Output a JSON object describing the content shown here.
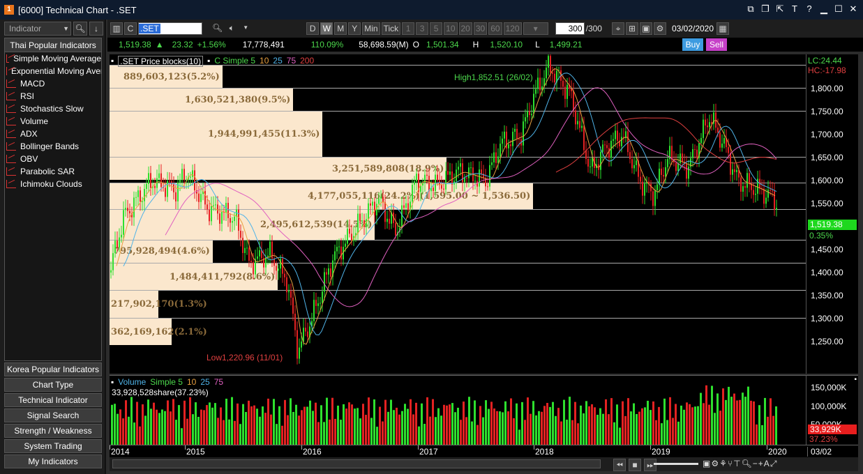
{
  "window": {
    "badge": "1",
    "title": "[6000] Technical Chart - .SET"
  },
  "sidebar": {
    "indicator_placeholder": "Indicator",
    "panel_title": "Thai Popular Indicators",
    "items": [
      "Simple Moving Average",
      "Exponential Moving Average",
      "MACD",
      "RSI",
      "Stochastics Slow",
      "Volume",
      "ADX",
      "Bollinger Bands",
      "OBV",
      "Parabolic SAR",
      "Ichimoku Clouds"
    ],
    "buttons": [
      "Korea Popular Indicators",
      "Chart Type",
      "Technical Indicator",
      "Signal Search",
      "Strength / Weakness",
      "System Trading",
      "My Indicators"
    ]
  },
  "toolbar": {
    "symbol": ".SET",
    "periods": [
      "D",
      "W",
      "M",
      "Y",
      "Min",
      "Tick"
    ],
    "active_period": "W",
    "intervals": [
      "1",
      "3",
      "5",
      "10",
      "20",
      "30",
      "60",
      "120"
    ],
    "count": "300",
    "count_total": "/300",
    "date": "03/02/2020"
  },
  "quote": {
    "last": "1,519.38",
    "change": "23.32",
    "change_pct": "+1.56%",
    "volume": "17,778,491",
    "vol_ratio": "110.09%",
    "value": "58,698.59(M)",
    "open_label": "O",
    "open": "1,501.34",
    "high_label": "H",
    "high": "1,520.10",
    "low_label": "L",
    "low": "1,499.21",
    "buy": "Buy",
    "sell": "Sell"
  },
  "chart": {
    "legend_block": ".SET Price blocks(10)",
    "legend_ma": "C Simple 5",
    "ma_periods": [
      "10",
      "25",
      "75",
      "200"
    ],
    "ma_colors": [
      "#4cd84c",
      "#e8a040",
      "#4fb3e8",
      "#e060c0",
      "#e04040"
    ],
    "high_label": "High1,852.51 (26/02)",
    "low_label": "Low1,220.96 (11/01)",
    "lc": "LC:24.44",
    "hc": "HC:-17.98",
    "last_price": "1,519.38",
    "last_pct": "0.35%",
    "y_ticks": [
      "1,800.00",
      "1,750.00",
      "1,700.00",
      "1,650.00",
      "1,600.00",
      "1,550.00",
      "1,500.00",
      "1,450.00",
      "1,400.00",
      "1,350.00",
      "1,300.00",
      "1,250.00"
    ],
    "price_blocks": [
      {
        "label": "889,603,123(5.2%)",
        "low": 1800,
        "high": 1850
      },
      {
        "label": "1,630,521,380(9.5%)",
        "low": 1750,
        "high": 1800
      },
      {
        "label": "1,944,991,455(11.3%)",
        "low": 1650,
        "high": 1750
      },
      {
        "label": "3,251,589,808(18.9%)",
        "low": 1600,
        "high": 1650
      },
      {
        "label": "4,177,055,116(24.2%)(1,595.00 ~ 1,536.50)",
        "low": 1536.5,
        "high": 1595
      },
      {
        "label": "2,495,612,539(14.5%)",
        "low": 1470,
        "high": 1536.5
      },
      {
        "label": "795,928,494(4.6%)",
        "low": 1420,
        "high": 1470
      },
      {
        "label": "1,484,411,792(8.6%)",
        "low": 1360,
        "high": 1420
      },
      {
        "label": "217,902,170(1.3%)",
        "low": 1300,
        "high": 1360
      },
      {
        "label": "362,169,162(2.1%)",
        "low": 1240,
        "high": 1300
      }
    ]
  },
  "volume": {
    "legend": "Volume",
    "ma_label": "Simple 5",
    "ma_periods": [
      "10",
      "25",
      "75"
    ],
    "current": "33,928,528share(37.23%)",
    "y_ticks": [
      "150,000K",
      "100,000K",
      "50,000K"
    ],
    "last_value": "33,929K",
    "last_pct": "37.23%"
  },
  "xaxis": {
    "labels": [
      "2014",
      "2015",
      "2016",
      "2017",
      "2018",
      "2019",
      "2020"
    ],
    "right": "03/02"
  }
}
